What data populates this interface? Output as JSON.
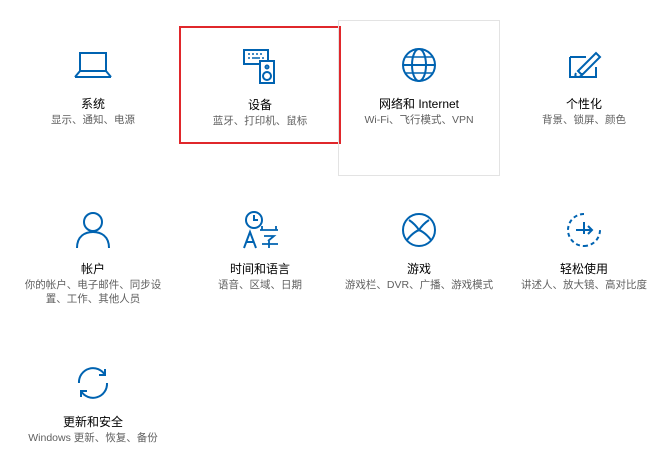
{
  "accent_color": "#0063b1",
  "selected_border_color": "#e0272b",
  "tiles": [
    {
      "title": "系统",
      "desc": "显示、通知、电源",
      "icon": "laptop-icon"
    },
    {
      "title": "设备",
      "desc": "蓝牙、打印机、鼠标",
      "icon": "devices-icon"
    },
    {
      "title": "网络和 Internet",
      "desc": "Wi-Fi、飞行模式、VPN",
      "icon": "globe-icon"
    },
    {
      "title": "个性化",
      "desc": "背景、锁屏、颜色",
      "icon": "paint-icon"
    },
    {
      "title": "帐户",
      "desc": "你的帐户、电子邮件、同步设置、工作、其他人员",
      "icon": "person-icon"
    },
    {
      "title": "时间和语言",
      "desc": "语音、区域、日期",
      "icon": "time-language-icon"
    },
    {
      "title": "游戏",
      "desc": "游戏栏、DVR、广播、游戏模式",
      "icon": "xbox-icon"
    },
    {
      "title": "轻松使用",
      "desc": "讲述人、放大镜、高对比度",
      "icon": "ease-of-access-icon"
    },
    {
      "title": "更新和安全",
      "desc": "Windows 更新、恢复、备份",
      "icon": "sync-icon"
    }
  ]
}
